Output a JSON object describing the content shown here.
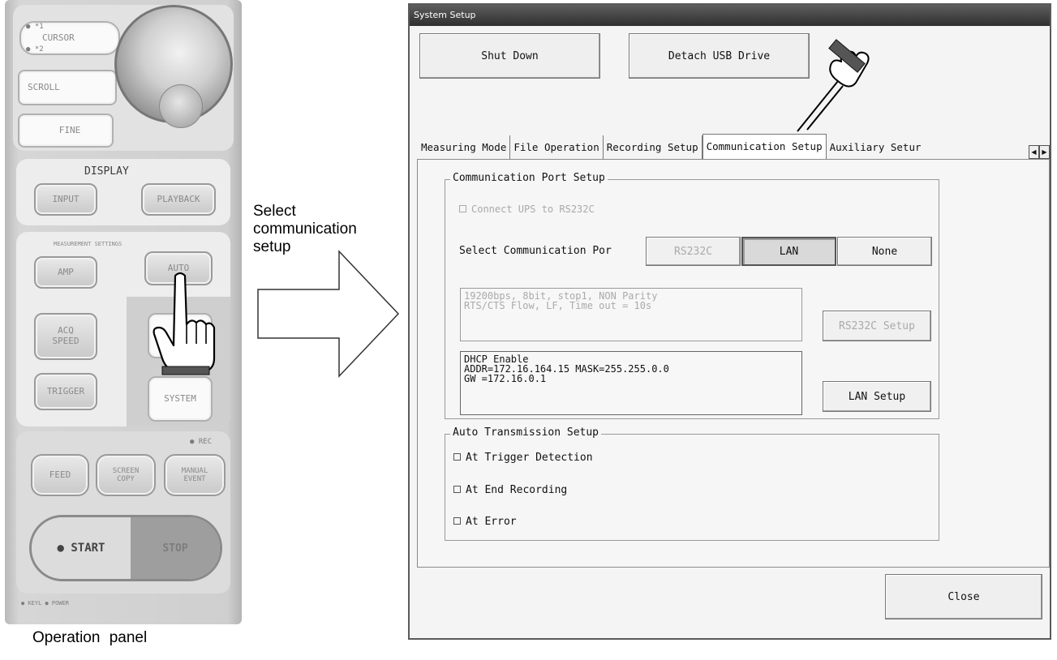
{
  "operation_panel": {
    "caption": "Operation  panel",
    "cursor_sublabels": [
      "● *1",
      "● *2"
    ],
    "cursor_label": "CURSOR",
    "scroll_label": "SCROLL",
    "fine_label": "FINE",
    "display_title": "DISPLAY",
    "input_label": "INPUT",
    "playback_label": "PLAYBACK",
    "meas_title": "MEASUREMENT SETTINGS",
    "amp_label": "AMP",
    "auto_label": "AUTO",
    "acq_speed_label": "ACQ\nSPEED",
    "trigger_label": "TRIGGER",
    "system_label": "SYSTEM",
    "feed_label": "FEED",
    "screen_copy_label": "SCREEN\nCOPY",
    "manual_event_label": "MANUAL\nEVENT",
    "rec_indicator": "● REC",
    "start_label": "● START",
    "stop_label": "STOP",
    "bottom_text": "● KEYL   ● POWER"
  },
  "annotation": {
    "select_text": "Select\ncommunication\nsetup"
  },
  "window": {
    "title": "System Setup",
    "shut_down_label": "Shut Down",
    "detach_usb_label": "Detach USB Drive",
    "tabs": [
      "Measuring Mode",
      "File Operation",
      "Recording Setup",
      "Communication Setup",
      "Auxiliary Setur"
    ],
    "active_tab": "Communication Setup",
    "comm_port_group_title": "Communication Port Setup",
    "ups_checkbox_label": "Connect UPS to RS232C",
    "select_port_label": "Select Communication Por",
    "port_options": [
      "RS232C",
      "LAN",
      "None"
    ],
    "selected_port": "LAN",
    "rs232c_info": "19200bps, 8bit, stop1, NON Parity\nRTS/CTS Flow, LF, Time out = 10s",
    "rs232c_setup_label": "RS232C Setup",
    "lan_info": "DHCP Enable\nADDR=172.16.164.15  MASK=255.255.0.0\nGW  =172.16.0.1",
    "lan_setup_label": "LAN Setup",
    "auto_tx_group_title": "Auto Transmission Setup",
    "auto_tx_options": [
      "At Trigger Detection",
      "At End Recording",
      "At Error"
    ],
    "close_label": "Close"
  }
}
